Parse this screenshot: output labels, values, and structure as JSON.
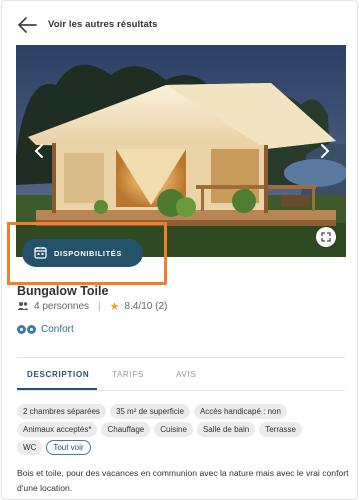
{
  "header": {
    "back_label": "Voir les autres résultats"
  },
  "gallery": {
    "image_alt": "bungalow-toile-photo"
  },
  "availability": {
    "label": "DISPONIBILITÉS"
  },
  "product": {
    "title": "Bungalow Toile",
    "capacity": "4 personnes",
    "rating": "8.4/10 (2)",
    "comfort": "Confort"
  },
  "tabs": [
    {
      "label": "DESCRIPTION",
      "active": true
    },
    {
      "label": "TARIFS",
      "active": false
    },
    {
      "label": "AVIS",
      "active": false
    }
  ],
  "tags": {
    "row1": [
      "2 chambres séparées",
      "35 m² de superficie",
      "Accès handicapé : non"
    ],
    "row2": [
      "Animaux acceptés*",
      "Chauffage",
      "Cuisine",
      "Salle de bain",
      "Terrasse"
    ],
    "row3": [
      "WC"
    ],
    "see_all": "Tout voir"
  },
  "description": "Bois et toile, pour des vacances en communion avec la nature mais avec le vrai confort d'une location.",
  "colors": {
    "primary": "#24526b",
    "highlight": "#f07f2b",
    "star": "#f0a020",
    "tag_bg": "#ebebeb"
  }
}
